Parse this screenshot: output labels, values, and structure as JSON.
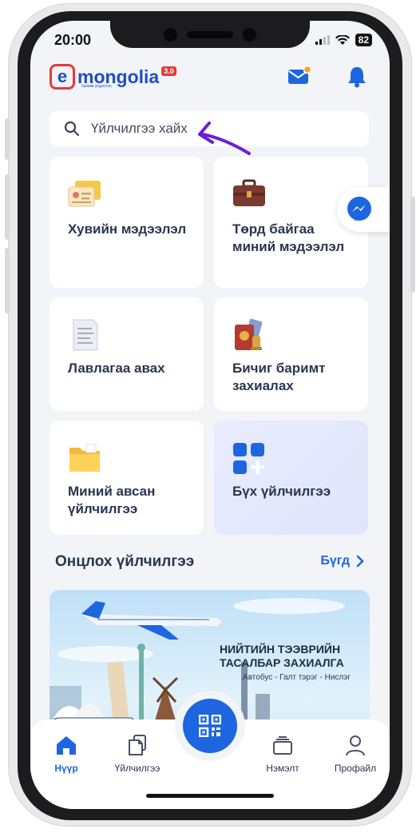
{
  "status_bar": {
    "time": "20:00",
    "battery": "82"
  },
  "header": {
    "logo_letter": "e",
    "logo_word": "mongolia",
    "logo_version": "3.0",
    "logo_tagline": "Цахим үндэстэн",
    "mail_icon": "mail-icon",
    "bell_icon": "bell-icon",
    "accent_color": "#1d66e0",
    "badge_color": "#f5a623"
  },
  "search": {
    "placeholder": "Үйлчилгээ хайх"
  },
  "cards": [
    {
      "label": "Хувийн мэдээлэл",
      "icon": "id-card-icon"
    },
    {
      "label": "Төрд байгаа миний мэдээлэл",
      "icon": "briefcase-icon"
    },
    {
      "label": "Лавлагаа авах",
      "icon": "document-icon"
    },
    {
      "label": "Бичиг баримт захиалах",
      "icon": "passport-icon"
    },
    {
      "label": "Миний авсан үйлчилгээ",
      "icon": "folder-icon"
    },
    {
      "label": "Бүх үйлчилгээ",
      "icon": "grid-icon"
    }
  ],
  "featured": {
    "title": "Онцлох үйлчилгээ",
    "see_all": "Бүгд"
  },
  "banner": {
    "title": "НИЙТИЙН ТЭЭВРИЙН ТАСАЛБАР ЗАХИАЛГА",
    "subtitle": "Автобус - Галт тэрэг - Нислэг"
  },
  "tabbar": {
    "tabs": [
      {
        "label": "Нүүр",
        "icon": "home-icon",
        "active": true
      },
      {
        "label": "Үйлчилгээ",
        "icon": "documents-icon",
        "active": false
      },
      {
        "label": "Нэмэлт",
        "icon": "layers-icon",
        "active": false
      },
      {
        "label": "Профайл",
        "icon": "user-icon",
        "active": false
      }
    ],
    "center_icon": "qr-code-icon"
  }
}
